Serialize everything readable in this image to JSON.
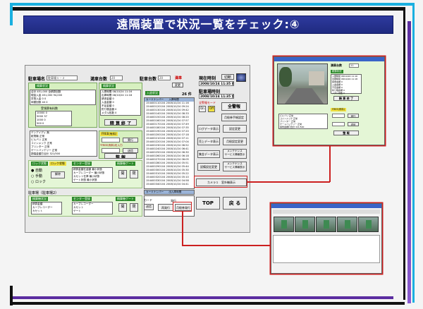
{
  "slide": {
    "title": "遠隔装置で状況一覧をチェック:④",
    "colors": {
      "title_bg": "#2e3a9e",
      "accent_cyan": "#1ab0e0",
      "accent_purple": "#5b2da0",
      "highlight_red": "#cc2020"
    }
  },
  "app": {
    "header": {
      "lot_name_label": "駐車場名",
      "lot_name_value": "駐車場１－２",
      "full_count_label": "満車台数",
      "full_count_value": "20",
      "parked_label": "駐車台数",
      "parked_value": "20",
      "full_flag": "満車",
      "change_button": "変更",
      "current_time_label": "現在時刻",
      "current_time": "2008/10/24 11:35 金",
      "switch_button": "切断",
      "parked_time_label": "駐車場時刻",
      "parked_time": "2008/10/24 11:35 金"
    },
    "sales": {
      "section": "精算状況",
      "rows": [
        {
          "label": "合計",
          "v1": "451,000",
          "v2": "全精算回数"
        },
        {
          "label": "現金入金",
          "v1": "451,000",
          "v2": "94,000"
        },
        {
          "label": "貨幣入金",
          "v1": "0",
          "v2": "0"
        },
        {
          "label": "両替回数",
          "v1": "40",
          "v2": "0"
        }
      ],
      "count_header": "受領票有料数",
      "counts": [
        {
          "label": "10000",
          "v": "0"
        },
        {
          "label": "5000",
          "v": "37"
        },
        {
          "label": "1000",
          "v": "0"
        },
        {
          "label": "500",
          "v": "0"
        }
      ]
    },
    "finish_panel": {
      "section": "精算状況",
      "rows": [
        {
          "label": "入庫時間",
          "v": "08/10/24 11:16"
        },
        {
          "label": "出庫時間",
          "v": "08/10/24 11:18"
        },
        {
          "label": "請求金額",
          "v": "0"
        },
        {
          "label": "入金金額",
          "v": "0"
        },
        {
          "label": "不足金額",
          "v": "0"
        },
        {
          "label": "釣り銭金額",
          "v": "0"
        },
        {
          "label": "メダル枚数",
          "v": "0"
        }
      ],
      "button": "精 算 終 了"
    },
    "devices": {
      "rows": [
        {
          "label": "テンアイディ",
          "v": "無"
        },
        {
          "label": "紙幣機",
          "v": "正常"
        },
        {
          "label": "ビルバリ",
          "v": "正常"
        },
        {
          "label": "コインメック",
          "v": "正常"
        },
        {
          "label": "プリンター",
          "v": "正常"
        },
        {
          "label": "ゲートバッテリー",
          "v": "正常"
        },
        {
          "label": "損傷金額打合計",
          "v": "321/500"
        }
      ]
    },
    "fee_panel": {
      "label": "FREE(有料)",
      "note": "*FREE(有料)を入力",
      "exec_button": "実行",
      "send_button": "送信",
      "reset_button": "整 報"
    },
    "lock_section": {
      "mode_tag": "ロック状態",
      "lock_tag": "ロック状態",
      "options": [
        "自動",
        "手動",
        "ロック"
      ],
      "release_button": "解除",
      "center_tag": "センター登録",
      "center_rows": [
        "精算金額在金額",
        "カーブレコーダー",
        "カセット在庫",
        "ゲート状態"
      ],
      "values": [
        "最小状態",
        "最小状態",
        "最小状態",
        "最小状態"
      ],
      "gate_tag": "精算機ゲート",
      "open_button": "開",
      "close_button": "閉"
    },
    "entry_section": {
      "title": "駐車場（駐車場2）",
      "sub_tag": "精算機状況",
      "center_tag": "センター登録",
      "gate_tag": "精算機ゲート",
      "rows": [
        "精算金額",
        "カーブレコーダー",
        "カセット",
        "ゲート"
      ],
      "open_button": "開",
      "close_button": "閉"
    },
    "log": {
      "title": "入退状況",
      "count": "26 件",
      "columns": [
        "カードナンバー",
        "入庫時間"
      ],
      "rows": [
        [
          "154400110104",
          "2008/10/24 11:16"
        ],
        [
          "154400120104",
          "2008/10/24 09:24"
        ],
        [
          "154400130104",
          "2008/10/24 09:42"
        ],
        [
          "154400140104",
          "2008/10/24 08:33"
        ],
        [
          "154400150104",
          "2008/10/24 08:20"
        ],
        [
          "154400160104",
          "2008/10/24 07:57"
        ],
        [
          "154400170104",
          "2008/10/24 07:49"
        ],
        [
          "154400180104",
          "2008/10/24 07:35"
        ],
        [
          "154400190104",
          "2008/10/24 07:20"
        ],
        [
          "154400200104",
          "2008/10/24 07:18"
        ],
        [
          "154400210104",
          "2008/10/24 07:11"
        ],
        [
          "154400220104",
          "2008/10/24 07:04"
        ],
        [
          "154400230104",
          "2008/10/24 06:52"
        ],
        [
          "154400240104",
          "2008/10/24 06:41"
        ],
        [
          "154400250104",
          "2008/10/24 06:30"
        ],
        [
          "154400260104",
          "2008/10/24 06:18"
        ],
        [
          "154400270104",
          "2008/10/24 06:05"
        ],
        [
          "154400280104",
          "2008/10/24 05:51"
        ],
        [
          "154400290104",
          "2008/10/24 05:44"
        ],
        [
          "154400300104",
          "2008/10/24 05:30"
        ],
        [
          "154400310104",
          "2008/10/24 05:22"
        ],
        [
          "154400320104",
          "2008/10/24 05:10"
        ],
        [
          "154400330104",
          "2008/10/24 04:58"
        ],
        [
          "154400340104",
          "2008/10/24 04:41"
        ]
      ],
      "footer": [
        "カードナンバー",
        "出入庫時間"
      ]
    },
    "right_buttons": {
      "all_alarm_label": "全警報モード",
      "on": "On",
      "off": "Off",
      "full_alarm": "全警報",
      "monthly_contract": "月極券手帳設定",
      "log_data": "ログデータ表示",
      "setting_change": "設定変更",
      "sales_data": "売上データ表示",
      "monthly_change": "月極設定変更",
      "collect_data": "集金データ表示",
      "maintenance_1": "メンテナンス\nサービス情報表示",
      "equipment_setting": "設備設定変更",
      "maintenance_2": "メンテナンス\nサービス情報表示",
      "camera_button": "カメラ１　室外機表示",
      "card_label": "カード",
      "send_button": "送信",
      "issue_label": "発行",
      "reissue_button": "再発行",
      "monthly_issue": "月極券発行",
      "top_button": "TOP",
      "back_button": "戻 る"
    }
  },
  "camera_window": {
    "title": "Camera 1",
    "full_count_label": "満車台数",
    "full_count_value": "20",
    "section": "精算状況",
    "rows": [
      {
        "label": "入庫時間",
        "v": "08/10/24 11:16"
      },
      {
        "label": "出庫時間",
        "v": "08/10/24 11:18"
      },
      {
        "label": "請求金額",
        "v": "0"
      },
      {
        "label": "入金金額",
        "v": "0"
      },
      {
        "label": "不足金額",
        "v": "0"
      },
      {
        "label": "釣り銭金額",
        "v": "0"
      },
      {
        "label": "メダル枚数",
        "v": "0"
      }
    ],
    "finish_button": "精 算 終 了",
    "devices": [
      {
        "label": "ビルバリ",
        "v": "正常"
      },
      {
        "label": "コインメック",
        "v": "正常"
      },
      {
        "label": "プリンター",
        "v": "正常"
      },
      {
        "label": "ゲートバッテリー",
        "v": "正常"
      },
      {
        "label": "損傷金額打合計",
        "v": "321/500"
      }
    ],
    "fee_label": "FREE(有料)",
    "exec_button": "実行",
    "send_button": "送信",
    "reset_button": "整 報"
  },
  "recorder_window": {
    "title": "Recorder"
  }
}
